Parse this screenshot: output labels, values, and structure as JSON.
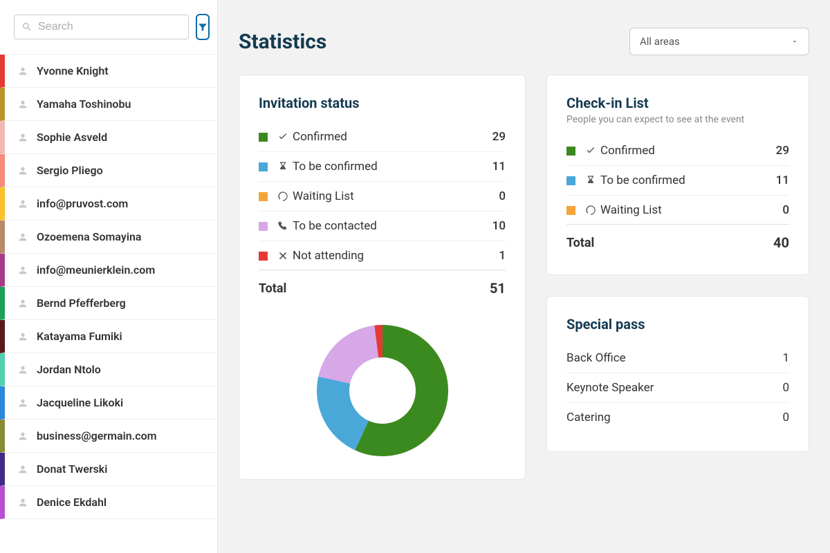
{
  "search": {
    "placeholder": "Search"
  },
  "people": [
    {
      "name": "Yvonne Knight",
      "color": "#e53935"
    },
    {
      "name": "Yamaha Toshinobu",
      "color": "#b8962a"
    },
    {
      "name": "Sophie Asveld",
      "color": "#f3b7b2"
    },
    {
      "name": "Sergio Pliego",
      "color": "#f58b7a"
    },
    {
      "name": "info@pruvost.com",
      "color": "#f9c22b"
    },
    {
      "name": "Ozoemena Somayina",
      "color": "#b78a6a"
    },
    {
      "name": "info@meunierklein.com",
      "color": "#a83a8a"
    },
    {
      "name": "Bernd Pfefferberg",
      "color": "#1fa05a"
    },
    {
      "name": "Katayama Fumiki",
      "color": "#5a1a1a"
    },
    {
      "name": "Jordan Ntolo",
      "color": "#4fd0b0"
    },
    {
      "name": "Jacqueline Likoki",
      "color": "#2b88d8"
    },
    {
      "name": "business@germain.com",
      "color": "#8a8a3a"
    },
    {
      "name": "Donat Twerski",
      "color": "#3f2a8a"
    },
    {
      "name": "Denice Ekdahl",
      "color": "#b84fd0"
    }
  ],
  "page": {
    "title": "Statistics"
  },
  "area_filter": {
    "selected": "All areas"
  },
  "cards": {
    "invitation": {
      "title": "Invitation status",
      "items": [
        {
          "label": "Confirmed",
          "value": 29,
          "color": "#3b8a1f",
          "icon": "check"
        },
        {
          "label": "To be confirmed",
          "value": 11,
          "color": "#4aa8d8",
          "icon": "hourglass"
        },
        {
          "label": "Waiting List",
          "value": 0,
          "color": "#f2a63a",
          "icon": "spinner"
        },
        {
          "label": "To be contacted",
          "value": 10,
          "color": "#d7a8e8",
          "icon": "phone"
        },
        {
          "label": "Not attending",
          "value": 1,
          "color": "#e53935",
          "icon": "x"
        }
      ],
      "total_label": "Total",
      "total_value": 51
    },
    "checkin": {
      "title": "Check-in List",
      "subtitle": "People you can expect to see at the event",
      "items": [
        {
          "label": "Confirmed",
          "value": 29,
          "color": "#3b8a1f",
          "icon": "check"
        },
        {
          "label": "To be confirmed",
          "value": 11,
          "color": "#4aa8d8",
          "icon": "hourglass"
        },
        {
          "label": "Waiting List",
          "value": 0,
          "color": "#f2a63a",
          "icon": "spinner"
        }
      ],
      "total_label": "Total",
      "total_value": 40
    },
    "special_pass": {
      "title": "Special pass",
      "items": [
        {
          "label": "Back Office",
          "value": 1
        },
        {
          "label": "Keynote Speaker",
          "value": 0
        },
        {
          "label": "Catering",
          "value": 0
        }
      ]
    }
  },
  "chart_data": {
    "type": "pie",
    "title": "Invitation status",
    "categories": [
      "Confirmed",
      "To be confirmed",
      "Waiting List",
      "To be contacted",
      "Not attending"
    ],
    "values": [
      29,
      11,
      0,
      10,
      1
    ],
    "colors": [
      "#3b8a1f",
      "#4aa8d8",
      "#f2a63a",
      "#d7a8e8",
      "#e53935"
    ]
  }
}
